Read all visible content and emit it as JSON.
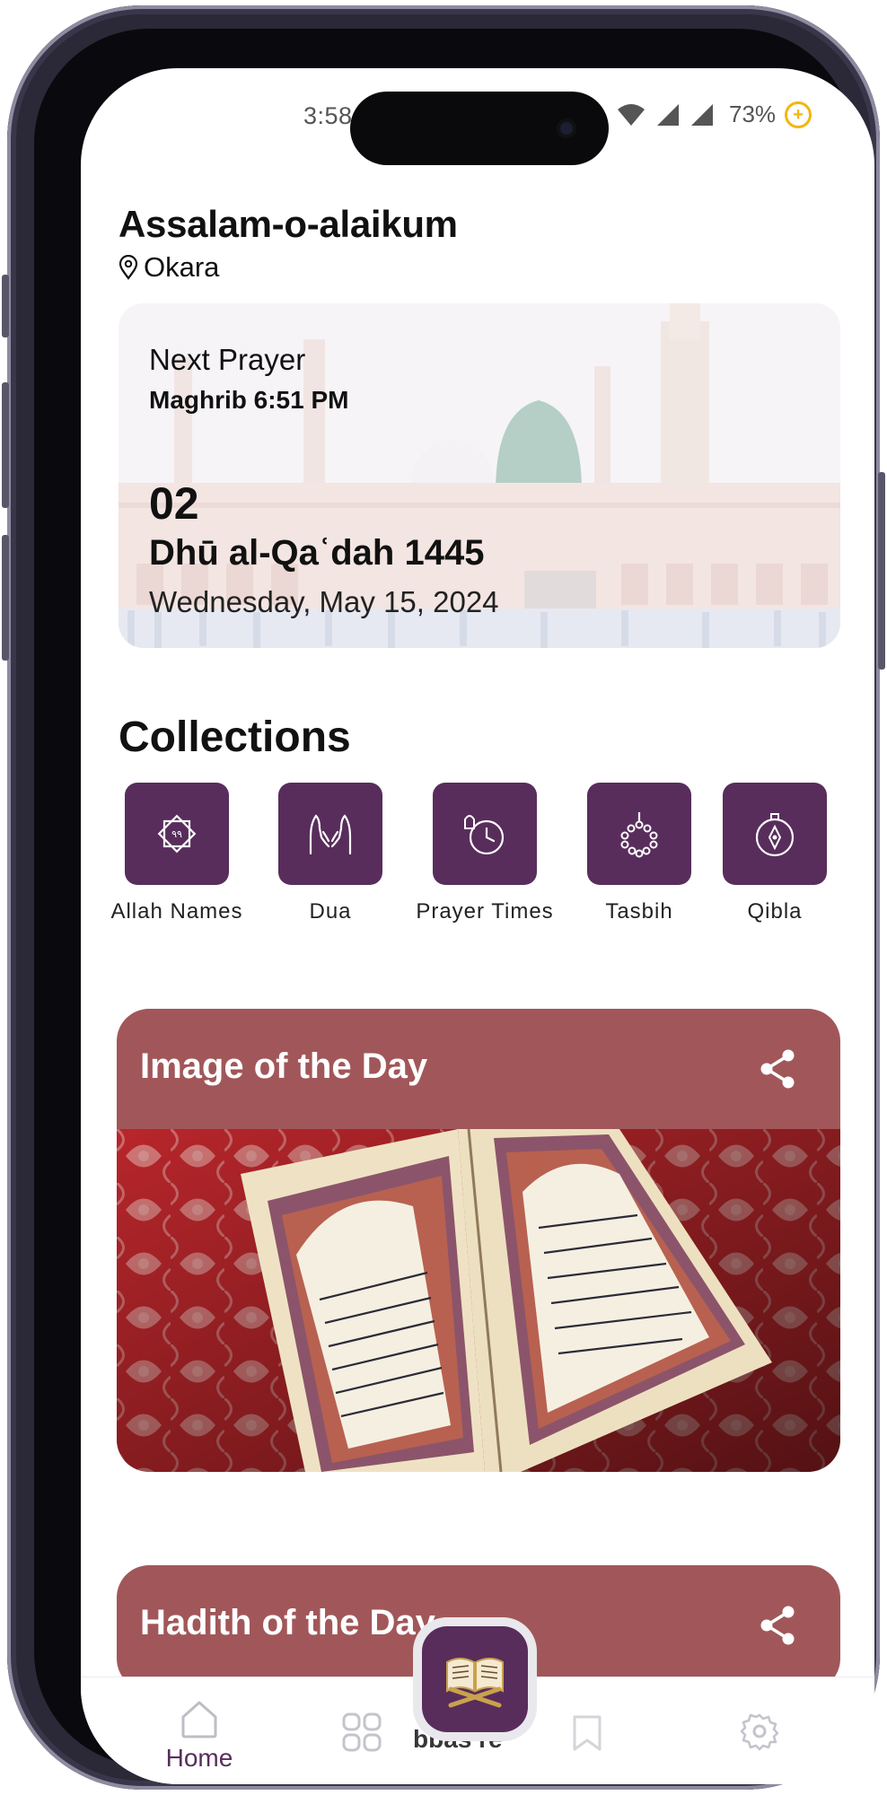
{
  "status_bar": {
    "time": "3:58",
    "battery_percent": "73%"
  },
  "header": {
    "greeting": "Assalam-o-alaikum",
    "location": "Okara"
  },
  "prayer_card": {
    "label": "Next Prayer",
    "prayer_time": "Maghrib 6:51 PM",
    "hijri_day": "02",
    "hijri_month_year": "Dhū al-Qaʿdah 1445",
    "gregorian_date": "Wednesday, May 15, 2024"
  },
  "collections": {
    "title": "Collections",
    "items": [
      {
        "label": "Allah Names",
        "icon": "allah-names-icon"
      },
      {
        "label": "Dua",
        "icon": "praying-hands-icon"
      },
      {
        "label": "Prayer Times",
        "icon": "prayer-clock-icon"
      },
      {
        "label": "Tasbih",
        "icon": "tasbih-beads-icon"
      },
      {
        "label": "Qibla",
        "icon": "compass-icon"
      }
    ]
  },
  "image_of_day": {
    "title": "Image of the Day"
  },
  "hadith_of_day": {
    "title": "Hadith of the Day"
  },
  "bottom_nav": {
    "home_label": "Home",
    "hidden_label": "bbas re"
  },
  "colors": {
    "accent_purple": "#582d5c",
    "card_red": "#a15759"
  }
}
